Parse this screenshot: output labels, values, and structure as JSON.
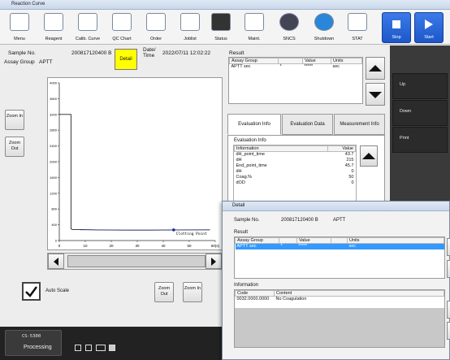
{
  "window": {
    "title": "Reaction Curve"
  },
  "toolbar": {
    "buttons": [
      {
        "label": "Menu"
      },
      {
        "label": "Reagent"
      },
      {
        "label": "Calib. Curve"
      },
      {
        "label": "QC Chart"
      },
      {
        "label": "Order"
      },
      {
        "label": "Joblist"
      },
      {
        "label": "Status"
      },
      {
        "label": "Maint."
      },
      {
        "label": "SNCS"
      },
      {
        "label": "Shutdown"
      },
      {
        "label": "STAT"
      }
    ],
    "stop_label": "Stop",
    "start_label": "Start"
  },
  "sample": {
    "no_label": "Sample No.",
    "no_value": "200817120400 B",
    "detail_label": "Detail",
    "datetime_label": "Date/ Time",
    "datetime_value": "2022/07/11 12:02:22",
    "assay_group_label": "Assay Group",
    "assay_group_value": "APTT"
  },
  "result": {
    "title": "Result",
    "headers": [
      "Assay Group",
      "",
      "Value",
      "Units"
    ],
    "rows": [
      [
        "APTT sec",
        "*",
        "*****",
        "sec"
      ]
    ]
  },
  "chart_data": {
    "type": "line",
    "x_ticks": [
      "0",
      "10",
      "20",
      "30",
      "40",
      "50",
      "60(s)"
    ],
    "y_ticks": [
      "0",
      "400",
      "800",
      "1200",
      "1600",
      "2000",
      "2400",
      "2800",
      "3200",
      "3600",
      "4000"
    ],
    "xlim": [
      0,
      60
    ],
    "ylim": [
      0,
      4000
    ],
    "series": [
      {
        "x": [
          0,
          4.5,
          4.5,
          5,
          8,
          15,
          25,
          35,
          45,
          58
        ],
        "y": [
          3200,
          3200,
          300,
          280,
          280,
          270,
          265,
          265,
          270,
          272
        ]
      }
    ],
    "annotation": "Clotting Point",
    "annotation_x": 44,
    "annotation_y": 270
  },
  "chart_controls": {
    "zoom_in_left": "Zoom In",
    "zoom_out_left": "Zoom Out",
    "auto_scale_label": "Auto Scale",
    "zoom_out_bottom": "Zoom Out",
    "zoom_in_bottom": "Zoom In"
  },
  "tabs": [
    "Evaluation Info",
    "Evaluation Data",
    "Measurement Info"
  ],
  "evaluation": {
    "title": "Evaluation Info",
    "headers": [
      "Information",
      "Value"
    ],
    "rows": [
      [
        "dH_point_time",
        "43.7"
      ],
      [
        "dH",
        "215"
      ],
      [
        "End_point_time",
        "45.7"
      ],
      [
        "dH",
        "0"
      ],
      [
        "Coag.%",
        "50"
      ],
      [
        "dOD",
        "0"
      ]
    ]
  },
  "side_buttons": [
    "Up",
    "Down",
    "Print"
  ],
  "status": {
    "device": "CS-5300",
    "state": "Processing"
  },
  "detail_dialog": {
    "title": "Detail",
    "sample_label": "Sample No.",
    "sample_value": "200817120400 B",
    "assay_value": "APTT",
    "result_title": "Result",
    "result_headers": [
      "Assay Group",
      "",
      "Value",
      "Units"
    ],
    "result_rows": [
      [
        "APTT sec",
        "*",
        "*****",
        "sec"
      ]
    ],
    "info_title": "Information",
    "info_headers": [
      "Code",
      "Content"
    ],
    "info_rows": [
      [
        "0032.0000.0000",
        "No Coagulation"
      ]
    ]
  }
}
